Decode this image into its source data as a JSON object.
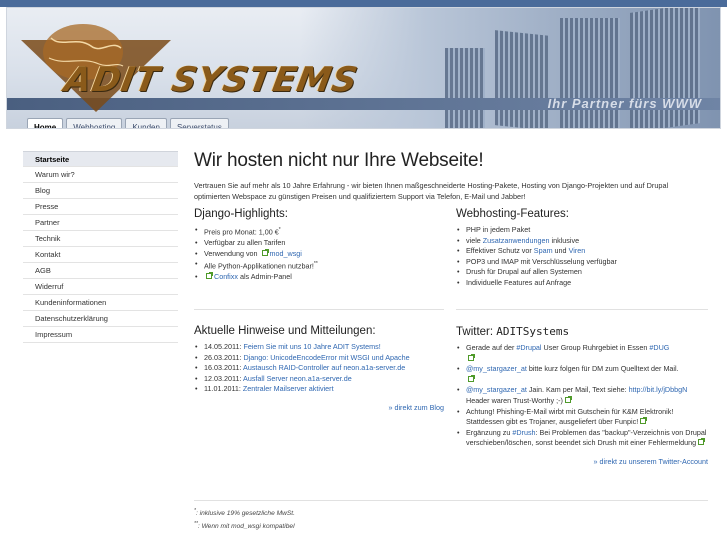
{
  "header": {
    "logo_text": "ADIT SYSTEMS",
    "slogan": "Ihr Partner fürs WWW",
    "tabs": [
      {
        "label": "Home",
        "active": true
      },
      {
        "label": "Webhosting",
        "active": false
      },
      {
        "label": "Kunden",
        "active": false
      },
      {
        "label": "Serverstatus",
        "active": false
      }
    ]
  },
  "sidebar": {
    "items": [
      {
        "label": "Startseite",
        "active": true
      },
      {
        "label": "Warum wir?"
      },
      {
        "label": "Blog"
      },
      {
        "label": "Presse"
      },
      {
        "label": "Partner"
      },
      {
        "label": "Technik"
      },
      {
        "label": "Kontakt"
      },
      {
        "label": "AGB"
      },
      {
        "label": "Widerruf"
      },
      {
        "label": "Kundeninformationen"
      },
      {
        "label": "Datenschutzerklärung"
      },
      {
        "label": "Impressum"
      }
    ]
  },
  "main": {
    "title": "Wir hosten nicht nur Ihre Webseite!",
    "intro": "Vertrauen Sie auf mehr als 10 Jahre Erfahrung - wir bieten Ihnen maßgeschneiderte Hosting-Pakete, Hosting von Django-Projekten und auf Drupal optimierten Webspace zu günstigen Preisen und qualifiziertem Support via Telefon, E-Mail und Jabber!",
    "django": {
      "heading": "Django-Highlights:",
      "items": [
        {
          "text": "Preis pro Monat: 1,00 €",
          "sup": "*"
        },
        {
          "text": "Verfügbar zu allen Tarifen"
        },
        {
          "prefix": "Verwendung von ",
          "link": "mod_wsgi"
        },
        {
          "text": "Alle Python-Applikationen nutzbar!",
          "sup": "**"
        },
        {
          "link": "Confixx",
          "suffix": " als Admin-Panel"
        }
      ]
    },
    "webhosting": {
      "heading": "Webhosting-Features:",
      "items": [
        {
          "text": "PHP in jedem Paket"
        },
        {
          "prefix": "viele ",
          "link": "Zusatzanwendungen",
          "suffix": " inklusive"
        },
        {
          "prefix": "Effektiver Schutz vor ",
          "link": "Spam",
          "middle": " und ",
          "link2": "Viren"
        },
        {
          "text": "POP3 und IMAP mit Verschlüsselung verfügbar"
        },
        {
          "text": "Drush für Drupal auf allen Systemen"
        },
        {
          "text": "Individuelle Features auf Anfrage"
        }
      ]
    },
    "news": {
      "heading": "Aktuelle Hinweise und Mitteilungen:",
      "items": [
        {
          "date": "14.05.2011:",
          "link": "Feiern Sie mit uns 10 Jahre ADIT Systems!"
        },
        {
          "date": "26.03.2011:",
          "link": "Django: UnicodeEncodeError mit WSGI und Apache"
        },
        {
          "date": "16.03.2011:",
          "link": "Austausch RAID-Controller auf neon.a1a-server.de"
        },
        {
          "date": "12.03.2011:",
          "link": "Ausfall Server neon.a1a-server.de"
        },
        {
          "date": "11.01.2011:",
          "link": "Zentraler Mailserver aktiviert"
        }
      ],
      "more": "» direkt zum Blog"
    },
    "twitter": {
      "heading_prefix": "Twitter: ",
      "heading_handle": "ADITSystems",
      "items": [
        {
          "prefix": "Gerade auf der ",
          "link": "#Drupal",
          "middle": " User Group Ruhrgebiet in Essen ",
          "link2": "#DUG"
        },
        {
          "link": "@my_stargazer_at",
          "suffix": " bitte kurz folgen für DM zum Quelltext der Mail."
        },
        {
          "link": "@my_stargazer_at",
          "suffix": " Jain. Kam per Mail, Text siehe: ",
          "link2": "http://bit.ly/jDbbgN",
          "suffix2": " Header waren Trust-Worthy ;-)"
        },
        {
          "text": "Achtung! Phishing-E-Mail wirbt mit Gutschein für K&M Elektronik! Stattdessen gibt es Trojaner, ausgeliefert über Funpic!"
        },
        {
          "prefix": "Ergänzung zu ",
          "link": "#Drush",
          "suffix": ": Bei Problemen das \"backup\"-Verzeichnis von Drupal verschieben/löschen, sonst beendet sich Drush mit einer Fehlermeldung"
        }
      ],
      "more": "» direkt zu unserem Twitter-Account"
    }
  },
  "footnotes": {
    "f1_mark": "*",
    "f1_text": ": inklusive 19% gesetzliche MwSt.",
    "f2_mark": "**",
    "f2_text": ": Wenn mit mod_wsgi kompatibel"
  },
  "colors": {
    "link": "#2f67b1",
    "topbar": "#4a6b9a",
    "external_icon": "#4f9a2a"
  }
}
